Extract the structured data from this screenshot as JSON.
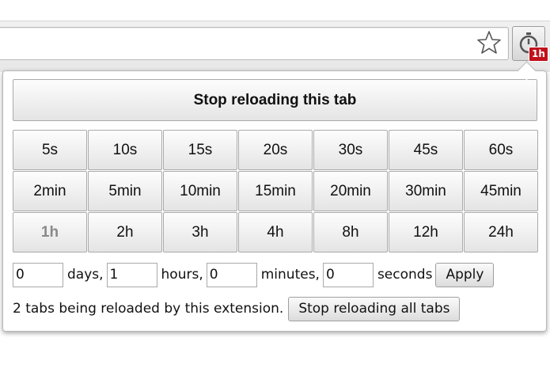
{
  "browser": {
    "extension_icon": "timer-icon",
    "extension_badge": "1h",
    "bookmark_icon": "star-outline-icon",
    "badge_color": "#c2111b"
  },
  "popup": {
    "stop_tab_label": "Stop reloading this tab",
    "intervals": [
      [
        "5s",
        "10s",
        "15s",
        "20s",
        "30s",
        "45s",
        "60s"
      ],
      [
        "2min",
        "5min",
        "10min",
        "15min",
        "20min",
        "30min",
        "45min"
      ],
      [
        "1h",
        "2h",
        "3h",
        "4h",
        "8h",
        "12h",
        "24h"
      ]
    ],
    "active_interval": "1h",
    "custom": {
      "days_value": "0",
      "days_label": "days,",
      "hours_value": "1",
      "hours_label": "hours,",
      "minutes_value": "0",
      "minutes_label": "minutes,",
      "seconds_value": "0",
      "seconds_label": "seconds",
      "apply_label": "Apply"
    },
    "status_text": "2 tabs being reloaded by this extension.",
    "stop_all_label": "Stop reloading all tabs"
  }
}
